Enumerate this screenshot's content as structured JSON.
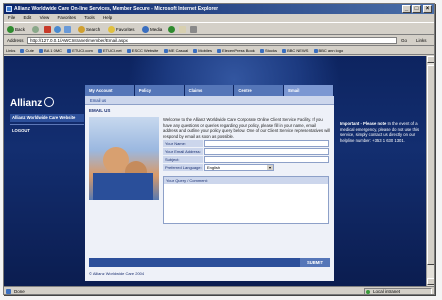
{
  "window": {
    "title": "Allianz Worldwide Care On-line Services, Member Secure - Microsoft Internet Explorer",
    "controls": [
      "_",
      "□",
      "×"
    ]
  },
  "menu": {
    "items": [
      "File",
      "Edit",
      "View",
      "Favorites",
      "Tools",
      "Help"
    ]
  },
  "toolbar": {
    "back": "Back",
    "search": "Search",
    "favorites": "Favorites",
    "media": "Media"
  },
  "address": {
    "label": "Address",
    "url": "http://127.0.0.1/AWCIntranet/member/Email.aspx",
    "go": "Go",
    "links": "Links"
  },
  "links_bar": [
    "Links",
    "Cute",
    "BA 1 0MC",
    "ETUCI.com",
    "ETUCI.net",
    "ESCC Website",
    "ME Casual",
    "Mobiles",
    "ElecenPress Book",
    "Stocks",
    "BBC NEWS",
    "BBC ann logo"
  ],
  "brand": {
    "name": "Allianz"
  },
  "leftnav": {
    "items": [
      "Allianz Worldwide Care Website",
      "LOGOUT"
    ]
  },
  "tabs": [
    "My Account",
    "Policy",
    "Claims",
    "Centre",
    "Email"
  ],
  "subbar": "Email us",
  "content": {
    "heading": "EMAIL US",
    "intro": "Welcome to the Allianz Worldwide Care Corporate Online Client Service Facility. If you have any questions or queries regarding your policy, please fill in your name, email address and outline your policy query below. One of our Client Service representatives will respond by email as soon as possible.",
    "form": {
      "name_label": "Your Name:",
      "email_label": "Your Email Address:",
      "subject_label": "Subject:",
      "language_label": "Preferred Language:",
      "language_value": "English",
      "query_label": "Your Query / Comment:"
    },
    "submit": "SUBMIT",
    "copyright": "© Allianz Worldwide Care 2004"
  },
  "notice": {
    "title": "Important - Please note",
    "body": "In the event of a medical emergency, please do not use this service, simply contact us directly on our helpline number: +353 1 630 1301."
  },
  "status": {
    "text": "Done",
    "zone": "Local intranet"
  },
  "colors": {
    "page_bg": "#0d2460",
    "tab": "#5576b8",
    "tab_active": "#7b97d2",
    "panel": "#eef1f8",
    "title_bar": "#0a246a"
  }
}
